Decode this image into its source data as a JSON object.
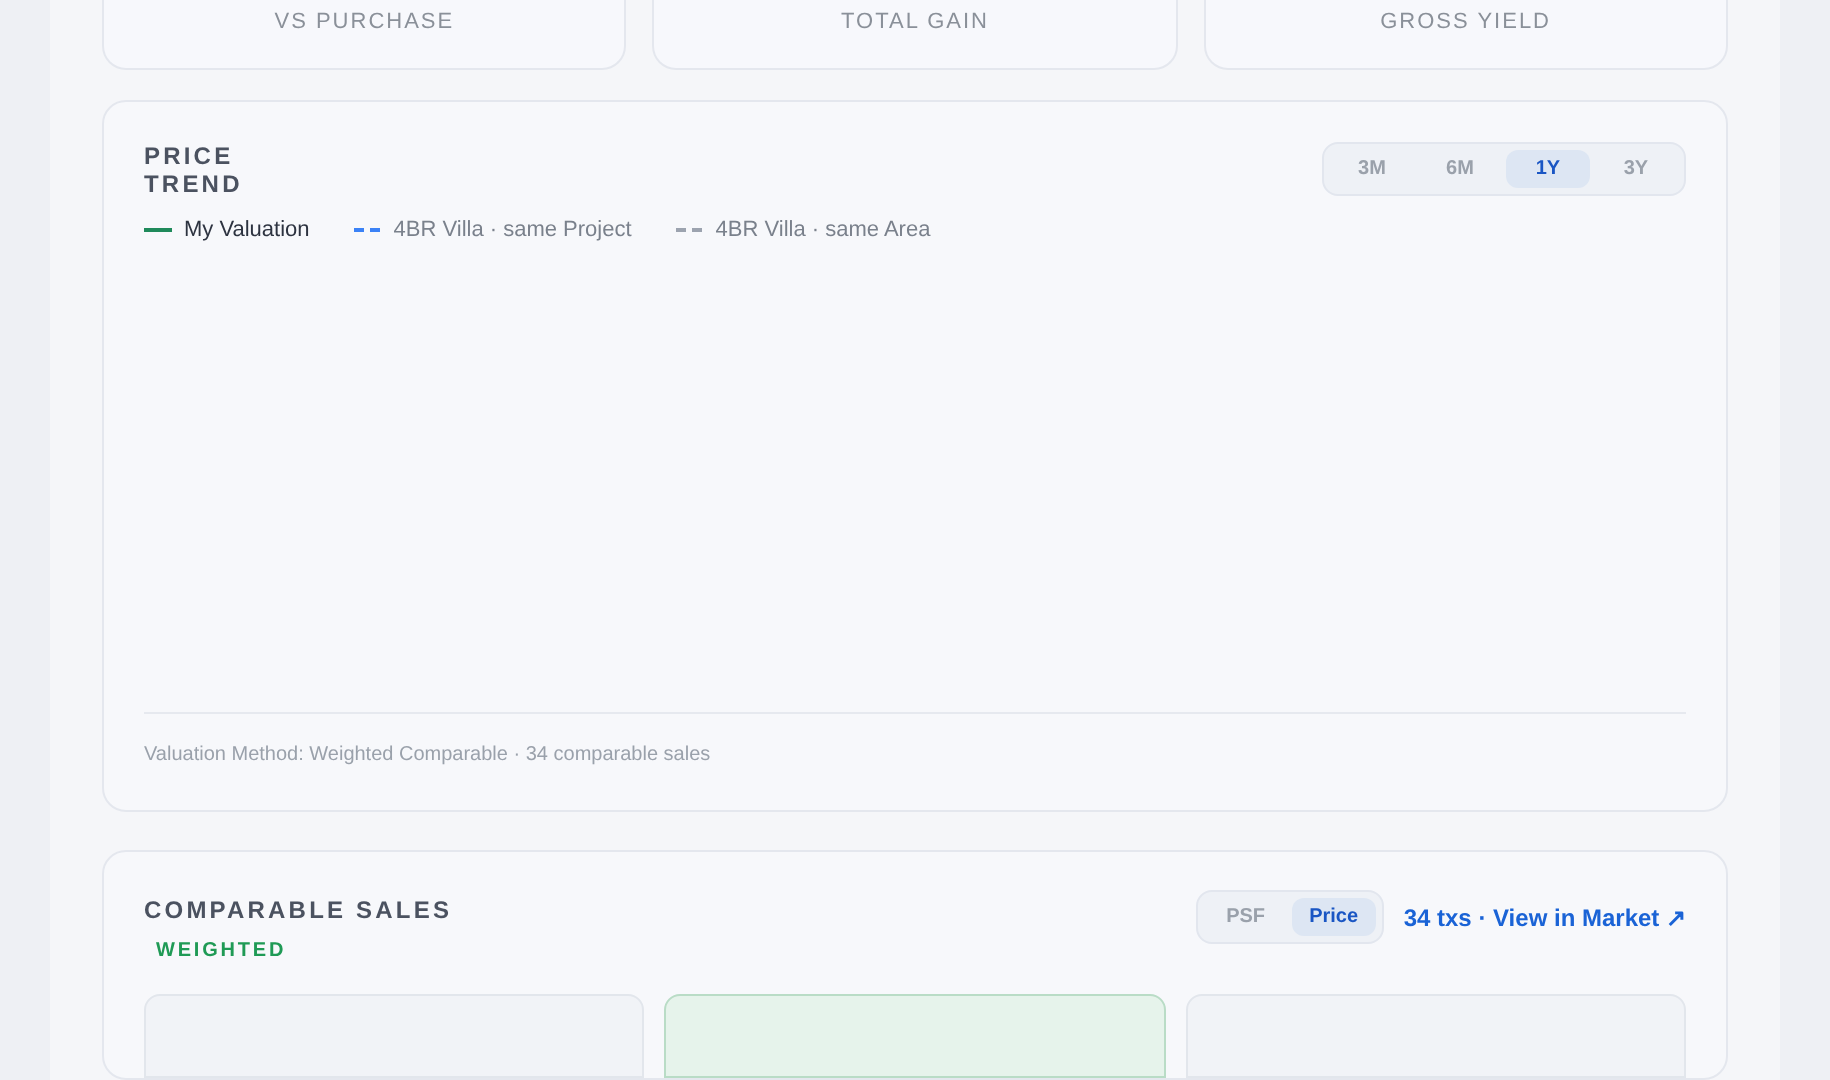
{
  "stat_cards": [
    {
      "label": "VS PURCHASE"
    },
    {
      "label": "TOTAL GAIN"
    },
    {
      "label": "GROSS YIELD"
    }
  ],
  "price_trend": {
    "title": "PRICE TREND",
    "ranges": [
      {
        "label": "3M",
        "selected": false
      },
      {
        "label": "6M",
        "selected": false
      },
      {
        "label": "1Y",
        "selected": true
      },
      {
        "label": "3Y",
        "selected": false
      }
    ],
    "legend": [
      {
        "label": "My Valuation",
        "color": "#1f8a5b",
        "kind": "solid"
      },
      {
        "label": "4BR Villa · same Project",
        "color": "#3b82f6",
        "kind": "dashed"
      },
      {
        "label": "4BR Villa · same Area",
        "color": "#9ca3af",
        "kind": "dashed"
      }
    ],
    "footnote": "Valuation Method: Weighted Comparable · 34 comparable sales"
  },
  "comparable_sales": {
    "title": "COMPARABLE SALES",
    "badge": "WEIGHTED",
    "modes": [
      {
        "label": "PSF",
        "selected": false
      },
      {
        "label": "Price",
        "selected": true
      }
    ],
    "link": "34 txs · View in Market ↗",
    "cards": [
      {
        "highlighted": false
      },
      {
        "highlighted": true
      },
      {
        "highlighted": false
      }
    ]
  }
}
